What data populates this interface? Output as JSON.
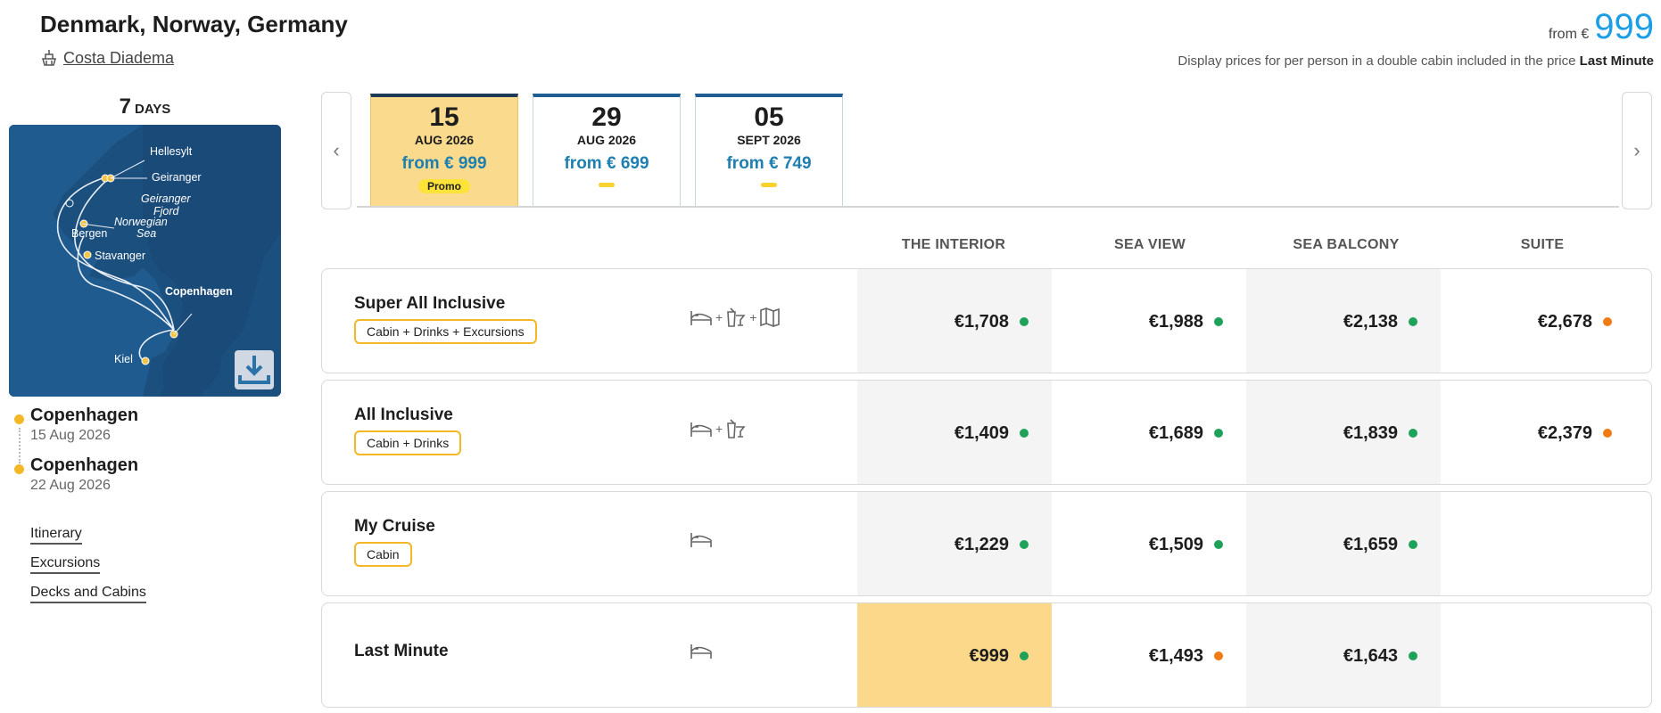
{
  "header": {
    "title": "Denmark, Norway, Germany",
    "ship": "Costa Diadema",
    "from_label": "from €",
    "from_price": "999",
    "disclaimer": "Display prices for per person in a double cabin included in the price",
    "disclaimer_bold": "Last Minute"
  },
  "itinerary": {
    "days_num": "7",
    "days_unit": "DAYS",
    "map_labels": [
      "Hellesylt",
      "Geiranger",
      "Geiranger",
      "Fjord",
      "Norwegian",
      "Sea",
      "Bergen",
      "Stavanger",
      "Copenhagen",
      "Kiel"
    ],
    "stops": [
      {
        "city": "Copenhagen",
        "date": "15 Aug 2026"
      },
      {
        "city": "Copenhagen",
        "date": "22 Aug 2026"
      }
    ],
    "links": [
      "Itinerary",
      "Excursions",
      "Decks and Cabins"
    ]
  },
  "dates": [
    {
      "day": "15",
      "month": "AUG 2026",
      "price": "from € 999",
      "badge": "Promo",
      "active": true
    },
    {
      "day": "29",
      "month": "AUG 2026",
      "price": "from € 699",
      "badge": "",
      "active": false
    },
    {
      "day": "05",
      "month": "SEPT 2026",
      "price": "from € 749",
      "badge": "",
      "active": false
    }
  ],
  "columns": [
    "THE INTERIOR",
    "SEA VIEW",
    "SEA BALCONY",
    "SUITE"
  ],
  "rows": [
    {
      "name": "Super All Inclusive",
      "tag": "Cabin + Drinks + Excursions",
      "icons": [
        "bed-icon",
        "drinks-icon",
        "map-icon"
      ],
      "prices": [
        {
          "v": "€1,708",
          "s": "green"
        },
        {
          "v": "€1,988",
          "s": "green"
        },
        {
          "v": "€2,138",
          "s": "green"
        },
        {
          "v": "€2,678",
          "s": "orange"
        }
      ]
    },
    {
      "name": "All Inclusive",
      "tag": "Cabin + Drinks",
      "icons": [
        "bed-icon",
        "drinks-icon"
      ],
      "prices": [
        {
          "v": "€1,409",
          "s": "green"
        },
        {
          "v": "€1,689",
          "s": "green"
        },
        {
          "v": "€1,839",
          "s": "green"
        },
        {
          "v": "€2,379",
          "s": "orange"
        }
      ]
    },
    {
      "name": "My Cruise",
      "tag": "Cabin",
      "icons": [
        "bed-icon"
      ],
      "prices": [
        {
          "v": "€1,229",
          "s": "green"
        },
        {
          "v": "€1,509",
          "s": "green"
        },
        {
          "v": "€1,659",
          "s": "green"
        }
      ]
    },
    {
      "name": "Last Minute",
      "tag": "",
      "icons": [
        "bed-icon"
      ],
      "prices": [
        {
          "v": "€999",
          "s": "green"
        },
        {
          "v": "€1,493",
          "s": "orange"
        },
        {
          "v": "€1,643",
          "s": "green"
        }
      ]
    }
  ],
  "colors": {
    "accent": "#1a9ee6",
    "tag_border": "#f4b826",
    "highlight": "#fcd98a",
    "available": "#1ea25a",
    "limited": "#f07b12"
  }
}
